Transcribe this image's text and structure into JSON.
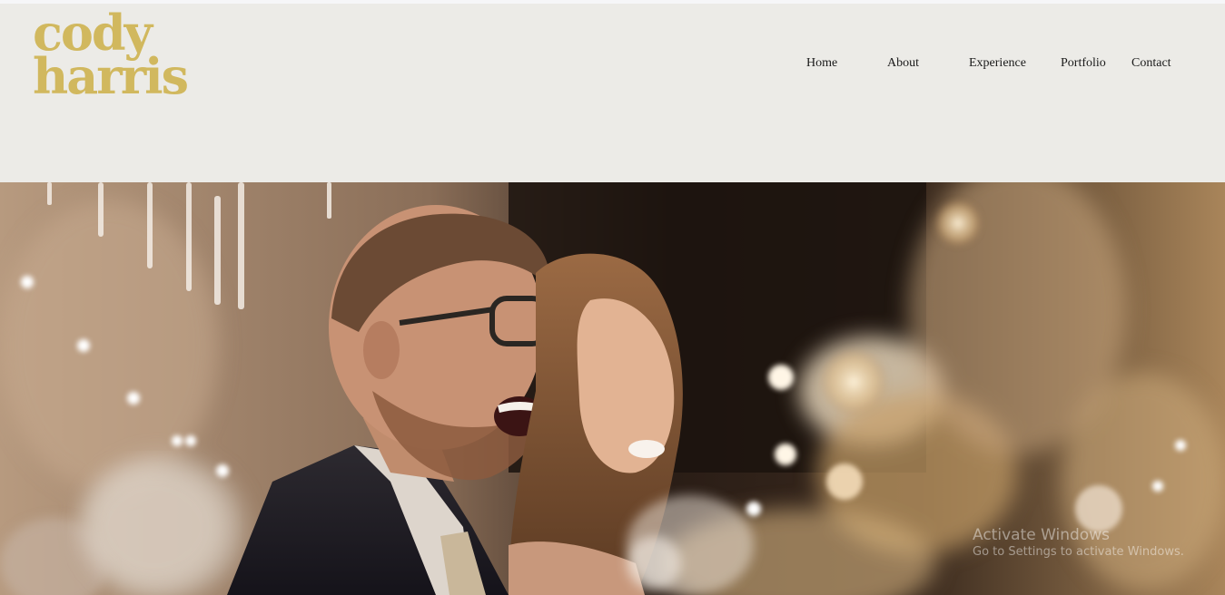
{
  "brand": {
    "line1": "cody",
    "line2": "harris",
    "color": "#d1b85e"
  },
  "nav": {
    "items": [
      {
        "label": "Home"
      },
      {
        "label": "About"
      },
      {
        "label": "Experience"
      },
      {
        "label": "Portfolio"
      },
      {
        "label": "Contact"
      }
    ]
  },
  "hero": {
    "image": "wedding-couple-laughing-photo"
  },
  "watermark": {
    "title": "Activate Windows",
    "subtitle": "Go to Settings to activate Windows."
  },
  "colors": {
    "header_background": "#ecebe7",
    "nav_text": "#1a1a1a"
  }
}
